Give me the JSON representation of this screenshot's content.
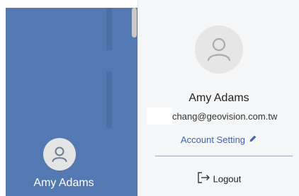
{
  "sidebar": {
    "user_name": "Amy Adams",
    "avatar_icon": "user-icon",
    "background_color": "#5479b2"
  },
  "profile_menu": {
    "avatar_icon": "user-icon",
    "user_name": "Amy Adams",
    "email": "chang@geovision.com.tw",
    "account_setting_label": "Account Setting",
    "account_setting_icon": "pencil-icon",
    "logout_label": "Logout",
    "logout_icon": "logout-icon",
    "link_color": "#3a66b0"
  }
}
